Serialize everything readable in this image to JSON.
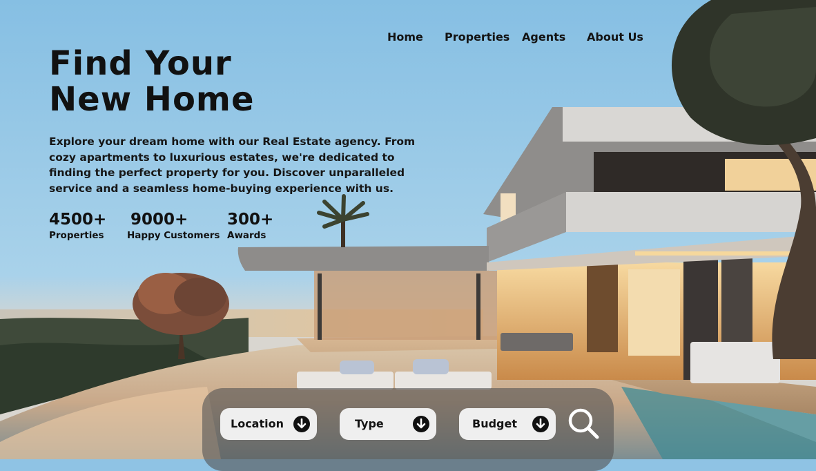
{
  "nav": {
    "items": [
      {
        "label": "Home"
      },
      {
        "label": "Properties"
      },
      {
        "label": "Agents"
      },
      {
        "label": "About Us"
      }
    ]
  },
  "hero": {
    "title_line1": "Find Your",
    "title_line2": "New Home",
    "description_lines": [
      "Explore your dream home with our Real Estate agency. From",
      "cozy apartments to luxurious estates, we're dedicated to",
      "finding the perfect property for you. Discover unparalleled",
      "service and a seamless home-buying experience with us."
    ]
  },
  "stats": [
    {
      "value": "4500+",
      "label": "Properties"
    },
    {
      "value": "9000+",
      "label": "Happy Customers"
    },
    {
      "value": "300+",
      "label": "Awards"
    }
  ],
  "search": {
    "filters": [
      {
        "label": "Location",
        "icon": "arrow-down-circle-icon"
      },
      {
        "label": "Type",
        "icon": "arrow-down-circle-icon"
      },
      {
        "label": "Budget",
        "icon": "arrow-down-circle-icon"
      }
    ],
    "search_icon": "search-icon"
  },
  "colors": {
    "sky": "#8fc3e4",
    "text": "#111111",
    "search_bar": "#555555",
    "filter_bg": "#efefef"
  }
}
